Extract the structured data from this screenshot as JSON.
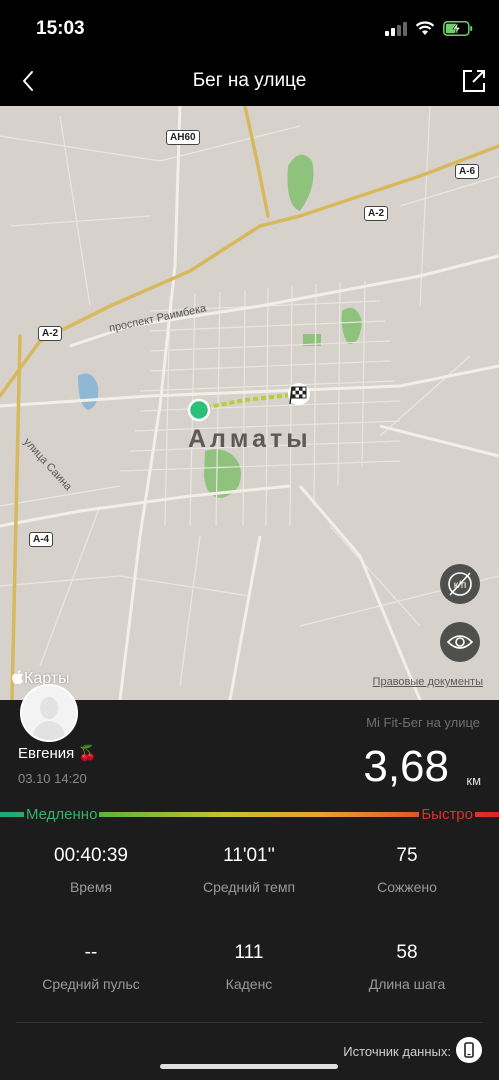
{
  "status": {
    "time": "15:03"
  },
  "nav": {
    "title": "Бег на улице"
  },
  "map": {
    "city": "Алматы",
    "street_labels": [
      "проспект Раимбека",
      "улица Саина"
    ],
    "route_badges": [
      "AH60",
      "A-6",
      "A-2",
      "A-2",
      "A-4"
    ],
    "logo": "Карты",
    "legal": "Правовые документы"
  },
  "workout": {
    "user_name": "Евгения 🍒",
    "date": "03.10 14:20",
    "source": "Mi Fit-Бег на улице",
    "distance": "3,68",
    "distance_unit": "км",
    "slow_label": "Медленно",
    "fast_label": "Быстро"
  },
  "stats": [
    {
      "value": "00:40:39",
      "label": "Время"
    },
    {
      "value": "11'01''",
      "label": "Средний темп"
    },
    {
      "value": "75",
      "label": "Сожжено"
    },
    {
      "value": "--",
      "label": "Средний пульс"
    },
    {
      "value": "111",
      "label": "Каденс"
    },
    {
      "value": "58",
      "label": "Длина шага"
    }
  ],
  "footer": {
    "data_source_label": "Источник данных:"
  },
  "colors": {
    "route_start": "#2bc07a",
    "speed_slow": "#33b36a",
    "speed_fast": "#d8322c",
    "panel_bg": "#1c1c1c"
  }
}
